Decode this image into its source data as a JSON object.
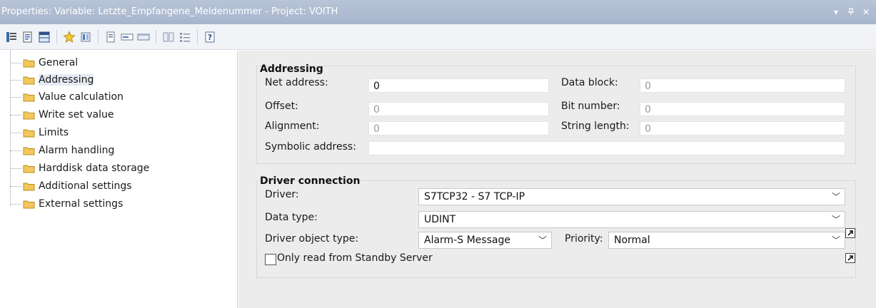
{
  "window": {
    "title": "Properties: Variable: Letzte_Empfangene_Meldenummer - Project: VOITH",
    "controls": [
      "▾",
      "ᵖ",
      "✕"
    ]
  },
  "toolbar": {
    "icons": [
      "list-view-icon",
      "properties-icon",
      "grid-icon",
      "favorite-star-icon",
      "book-icon",
      "page-icon",
      "field-icon",
      "window-icon",
      "columns-icon",
      "bullet-list-icon",
      "help-icon"
    ]
  },
  "tree": {
    "items": [
      {
        "label": "General"
      },
      {
        "label": "Addressing"
      },
      {
        "label": "Value calculation"
      },
      {
        "label": "Write set value"
      },
      {
        "label": "Limits"
      },
      {
        "label": "Alarm handling"
      },
      {
        "label": "Harddisk data storage"
      },
      {
        "label": "Additional settings"
      },
      {
        "label": "External settings"
      }
    ],
    "selected": "Addressing"
  },
  "addressing": {
    "title": "Addressing",
    "net_address_label": "Net address:",
    "net_address_value": "0",
    "data_block_label": "Data block:",
    "data_block_value": "0",
    "offset_label": "Offset:",
    "offset_value": "0",
    "bit_number_label": "Bit number:",
    "bit_number_value": "0",
    "alignment_label": "Alignment:",
    "alignment_value": "0",
    "string_length_label": "String length:",
    "string_length_value": "0",
    "symbolic_address_label": "Symbolic address:",
    "symbolic_address_value": ""
  },
  "driver_connection": {
    "title": "Driver connection",
    "driver_label": "Driver:",
    "driver_value": "S7TCP32 - S7 TCP-IP",
    "data_type_label": "Data type:",
    "data_type_value": "UDINT",
    "driver_object_type_label": "Driver object type:",
    "driver_object_type_value": "Alarm-S Message",
    "priority_label": "Priority:",
    "priority_value": "Normal",
    "standby_label": "Only read from Standby Server",
    "standby_checked": false
  },
  "colors": {
    "titlebar": "#a7b5cc",
    "panel": "#ececec",
    "folder": "#e8b84a"
  }
}
